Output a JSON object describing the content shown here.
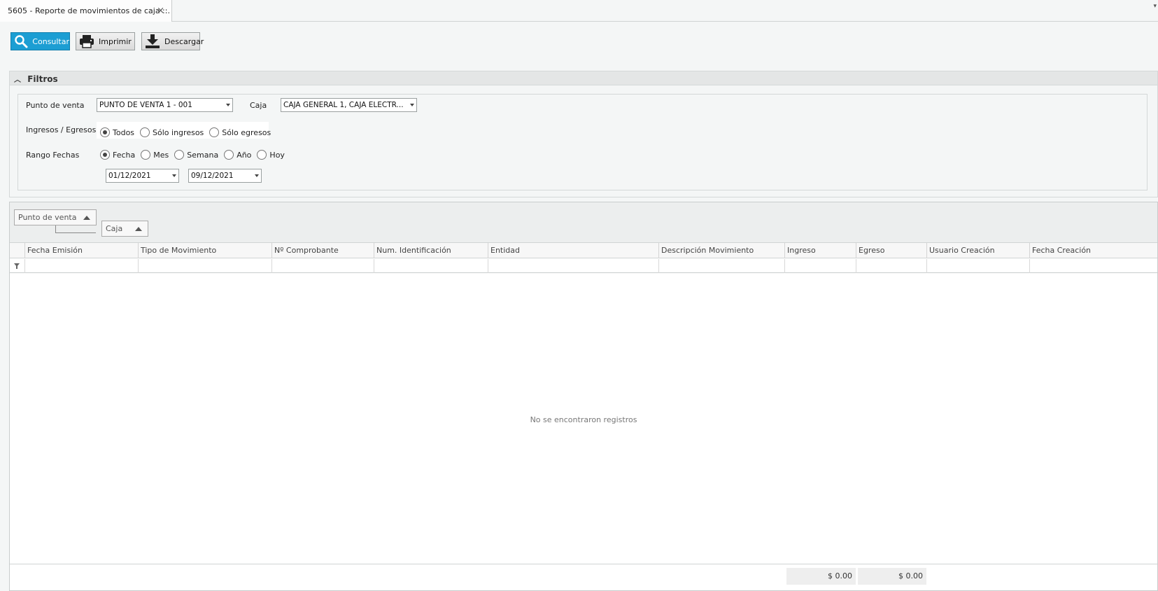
{
  "tab": {
    "title": "5605 - Reporte de movimientos de caja ::.",
    "close": "×"
  },
  "toolbar": {
    "consultar": "Consultar",
    "imprimir": "Imprimir",
    "descargar": "Descargar"
  },
  "filtros": {
    "title": "Filtros",
    "punto_venta_label": "Punto de venta",
    "punto_venta_value": "PUNTO DE VENTA 1 - 001",
    "caja_label": "Caja",
    "caja_value": "CAJA GENERAL 1, CAJA ELECTR...",
    "ingresos_label": "Ingresos / Egresos",
    "ingresos_options": [
      "Todos",
      "Sólo ingresos",
      "Sólo egresos"
    ],
    "ingresos_selected": "Todos",
    "rango_label": "Rango Fechas",
    "rango_options": [
      "Fecha",
      "Mes",
      "Semana",
      "Año",
      "Hoy"
    ],
    "rango_selected": "Fecha",
    "fecha_desde": "01/12/2021",
    "fecha_hasta": "09/12/2021"
  },
  "grid": {
    "group_chips": [
      "Punto de venta",
      "Caja"
    ],
    "columns": [
      "Fecha Emisión",
      "Tipo de Movimiento",
      "Nº Comprobante",
      "Num. Identificación",
      "Entidad",
      "Descripción Movimiento",
      "Ingreso",
      "Egreso",
      "Usuario Creación",
      "Fecha Creación"
    ],
    "empty_message": "No se encontraron registros",
    "totals": {
      "ingreso": "$ 0.00",
      "egreso": "$ 0.00"
    }
  }
}
